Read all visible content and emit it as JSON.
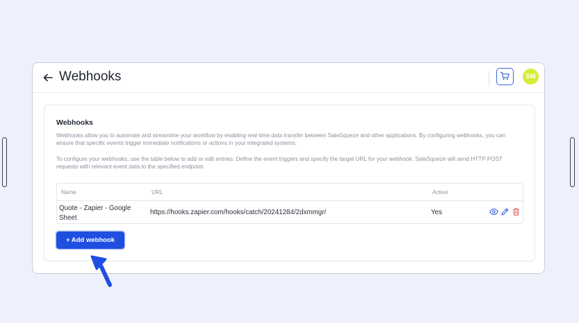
{
  "header": {
    "title": "Webhooks",
    "avatar_initials": "SM"
  },
  "card": {
    "title": "Webhooks",
    "description_1": "Webhooks allow you to automate and streamline your workflow by enabling real-time data transfer between SaleSqueze and other applications. By configuring webhooks, you can ensure that specific events trigger immediate notifications or actions in your integrated systems.",
    "description_2": "To configure your webhooks, use the table below to add or edit entries. Define the event triggers and specify the target URL for your webhook. SaleSqueze will send HTTP POST requests with relevant event data to the specified endpoint."
  },
  "table": {
    "columns": {
      "name": "Name",
      "url": "URL",
      "active": "Active"
    },
    "rows": [
      {
        "name": "Quote - Zapier - Google Sheet",
        "url": "https://hooks.zapier.com/hooks/catch/20241284/2dxmmgr/",
        "active": "Yes"
      }
    ]
  },
  "add_button_label": "+ Add webhook",
  "icons": {
    "back": "arrow-left-icon",
    "cart": "cart-icon",
    "view": "eye-icon",
    "edit": "pencil-icon",
    "delete": "trash-icon",
    "pointer": "arrow-pointer-icon"
  },
  "colors": {
    "primary": "#1f4fe0",
    "avatar": "#d7ec3a",
    "delete": "#e05a5a",
    "action": "#3d63dd"
  }
}
